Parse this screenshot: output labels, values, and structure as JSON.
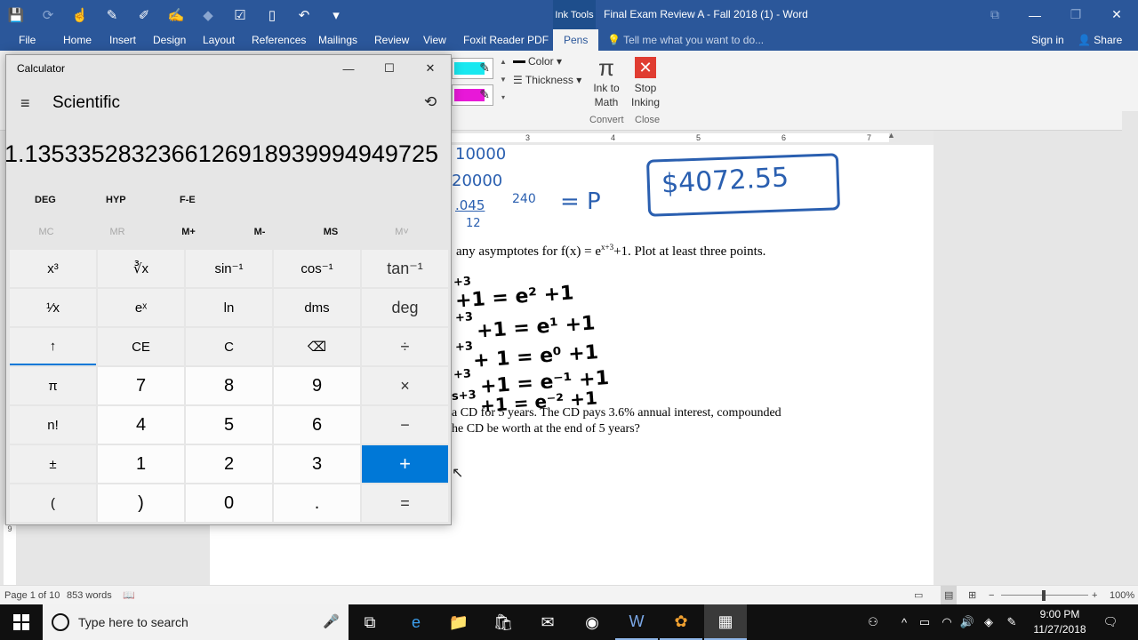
{
  "word": {
    "title": "Final Exam Review A - Fall 2018 (1) - Word",
    "context_tab": "Ink Tools",
    "tabs": [
      "File",
      "Home",
      "Insert",
      "Design",
      "Layout",
      "References",
      "Mailings",
      "Review",
      "View",
      "Foxit Reader PDF",
      "Pens"
    ],
    "tell_me": "Tell me what you want to do...",
    "sign_in": "Sign in",
    "share": "Share",
    "ribbon": {
      "color_label": "Color",
      "thickness_label": "Thickness",
      "ink_to_math": [
        "Ink to",
        "Math"
      ],
      "convert_group": "Convert",
      "stop_inking": [
        "Stop",
        "Inking"
      ],
      "close_group": "Close",
      "pen_colors": [
        "#18e8f0",
        "#e818d8"
      ]
    },
    "ruler_numbers": [
      "3",
      "4",
      "5",
      "6",
      "7"
    ],
    "status": {
      "page": "Page 1 of 10",
      "words": "853 words",
      "zoom": "100%"
    },
    "document": {
      "hw_top": "10000",
      "hw_line2": "20000",
      "hw_frac": ".045",
      "hw_den": "12",
      "hw_exp": "240",
      "hw_eq": "= P",
      "answer": "$4072.55",
      "problem1": "any asymptotes for f(x) = e",
      "problem1_exp": "x+3",
      "problem1_tail": "+1.  Plot at least three points.",
      "hw_rows": [
        "+3",
        "+1 = e² +1",
        "+3",
        "+1 = e¹ +1",
        "+3",
        "+ 1 = e⁰ +1",
        "+3",
        "+1 = e⁻¹ +1",
        "s+3",
        "+1 = e⁻² +1"
      ],
      "problem2_line1": "a CD for 5 years.  The CD pays 3.6% annual interest, compounded",
      "problem2_line2": "he CD be worth at the end of 5 years?"
    }
  },
  "calculator": {
    "title": "Calculator",
    "mode": "Scientific",
    "display": "1.1353352832366126918939994949725",
    "angle_modes": [
      "DEG",
      "HYP",
      "F-E"
    ],
    "memory": [
      {
        "label": "MC",
        "enabled": false
      },
      {
        "label": "MR",
        "enabled": false
      },
      {
        "label": "M+",
        "enabled": true
      },
      {
        "label": "M-",
        "enabled": true
      },
      {
        "label": "MS",
        "enabled": true
      },
      {
        "label": "M˅",
        "enabled": false
      }
    ],
    "keys": [
      [
        "x³",
        "∛x",
        "sin⁻¹",
        "cos⁻¹",
        "tan⁻¹"
      ],
      [
        "¹⁄x",
        "eˣ",
        "ln",
        "dms",
        "deg"
      ],
      [
        "↑",
        "CE",
        "C",
        "⌫",
        "÷"
      ],
      [
        "π",
        "7",
        "8",
        "9",
        "×"
      ],
      [
        "n!",
        "4",
        "5",
        "6",
        "−"
      ],
      [
        "±",
        "1",
        "2",
        "3",
        "+"
      ],
      [
        "(",
        ")",
        "0",
        ".",
        "="
      ]
    ]
  },
  "taskbar": {
    "search_placeholder": "Type here to search",
    "time": "9:00 PM",
    "date": "11/27/2018"
  }
}
